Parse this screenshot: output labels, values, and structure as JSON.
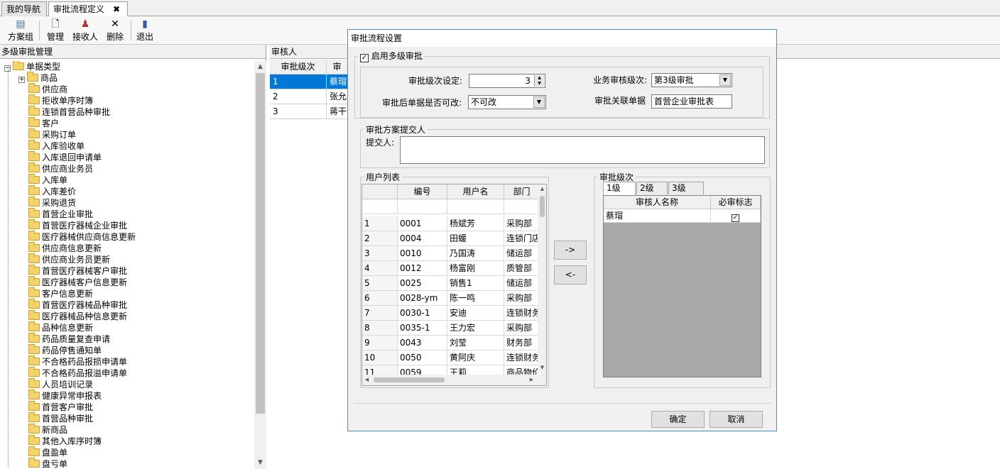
{
  "tabs": [
    {
      "label": "我的导航"
    },
    {
      "label": "审批流程定义"
    }
  ],
  "toolbar": {
    "scheme_group": "方案组",
    "manage": "管理",
    "receiver": "接收人",
    "delete": "删除",
    "exit": "退出"
  },
  "left": {
    "title": "多级审批管理",
    "root": "单据类型",
    "items": [
      "商品",
      "供应商",
      "拒收单序时簿",
      "连锁首营品种审批",
      "客户",
      "采购订单",
      "入库验收单",
      "入库退回申请单",
      "供应商业务员",
      "入库单",
      "入库差价",
      "采购退货",
      "首营企业审批",
      "首营医疗器械企业审批",
      "医疗器械供应商信息更新",
      "供应商信息更新",
      "供应商业务员更新",
      "首营医疗器械客户审批",
      "医疗器械客户信息更新",
      "客户信息更新",
      "首营医疗器械品种审批",
      "医疗器械品种信息更新",
      "品种信息更新",
      "药品质量复查申请",
      "药品停售通知单",
      "不合格药品报损申请单",
      "不合格药品报溢申请单",
      "人员培训记录",
      "健康异常申报表",
      "首营客户审批",
      "首营品种审批",
      "新商品",
      "其他入库序时簿",
      "盘盈单",
      "盘亏单"
    ]
  },
  "right": {
    "title": "审核人",
    "headers": [
      "审批级次",
      "审"
    ],
    "rows": [
      [
        "1",
        "蔡瑁"
      ],
      [
        "2",
        "张允"
      ],
      [
        "3",
        "蒋干"
      ]
    ]
  },
  "dialog": {
    "title": "审批流程设置",
    "enable_label": "启用多级审批",
    "level_label": "审批级次设定:",
    "level_value": "3",
    "biz_level_label": "业务审核级次:",
    "biz_level_value": "第3级审批",
    "modifiable_label": "审批后单据是否可改:",
    "modifiable_value": "不可改",
    "related_label": "审批关联单据",
    "related_value": "首营企业审批表",
    "submitter_group": "审批方案提交人",
    "submitter_label": "提交人:",
    "userlist_group": "用户列表",
    "user_headers": [
      "编号",
      "用户名",
      "部门"
    ],
    "users": [
      [
        "1",
        "0001",
        "杨斌芳",
        "采购部"
      ],
      [
        "2",
        "0004",
        "田蝯",
        "连锁门店"
      ],
      [
        "3",
        "0010",
        "乃国涛",
        "储运部"
      ],
      [
        "4",
        "0012",
        "杨富刚",
        "质管部"
      ],
      [
        "5",
        "0025",
        "销售1",
        "储运部"
      ],
      [
        "6",
        "0028-ym",
        "陈一鸣",
        "采购部"
      ],
      [
        "7",
        "0030-1",
        "安迪",
        "连锁财务"
      ],
      [
        "8",
        "0035-1",
        "王力宏",
        "采购部"
      ],
      [
        "9",
        "0043",
        "刘莹",
        "财务部"
      ],
      [
        "10",
        "0050",
        "黄阿庆",
        "连锁财务"
      ],
      [
        "11",
        "0059",
        "王莉",
        "商品物价"
      ]
    ],
    "add_btn": "->",
    "remove_btn": "<-",
    "level_group": "审批级次",
    "level_tabs": [
      "1级",
      "2级",
      "3级"
    ],
    "level_headers": [
      "审核人名称",
      "必审标志"
    ],
    "level_rows": [
      {
        "name": "蔡瑁",
        "required": "✓"
      }
    ],
    "ok": "确定",
    "cancel": "取消"
  }
}
